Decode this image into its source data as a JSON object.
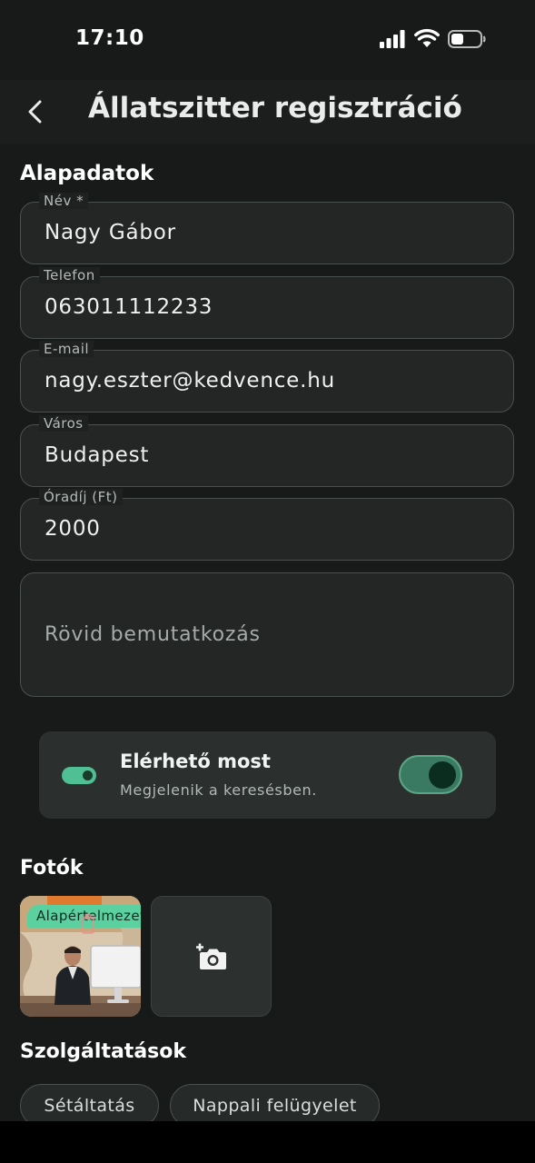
{
  "status_bar": {
    "time": "17:10"
  },
  "header": {
    "title": "Állatszitter regisztráció"
  },
  "basic_section": {
    "title": "Alapadatok",
    "fields": {
      "name": {
        "label": "Név *",
        "value": "Nagy Gábor"
      },
      "phone": {
        "label": "Telefon",
        "value": "063011112233"
      },
      "email": {
        "label": "E-mail",
        "value": "nagy.eszter@kedvence.hu"
      },
      "city": {
        "label": "Város",
        "value": "Budapest"
      },
      "rate": {
        "label": "Óradíj (Ft)",
        "value": "2000"
      },
      "intro": {
        "placeholder": "Rövid bemutatkozás"
      }
    }
  },
  "availability": {
    "title": "Elérhető most",
    "subtitle": "Megjelenik a keresésben.",
    "enabled": true
  },
  "photos": {
    "title": "Fotók",
    "default_badge": "Alapértelmezett"
  },
  "services": {
    "title": "Szolgáltatások",
    "items": [
      "Sétáltatás",
      "Nappali felügyelet"
    ]
  },
  "colors": {
    "accent": "#4fbf94",
    "background": "#171a19",
    "surface": "#232625"
  }
}
